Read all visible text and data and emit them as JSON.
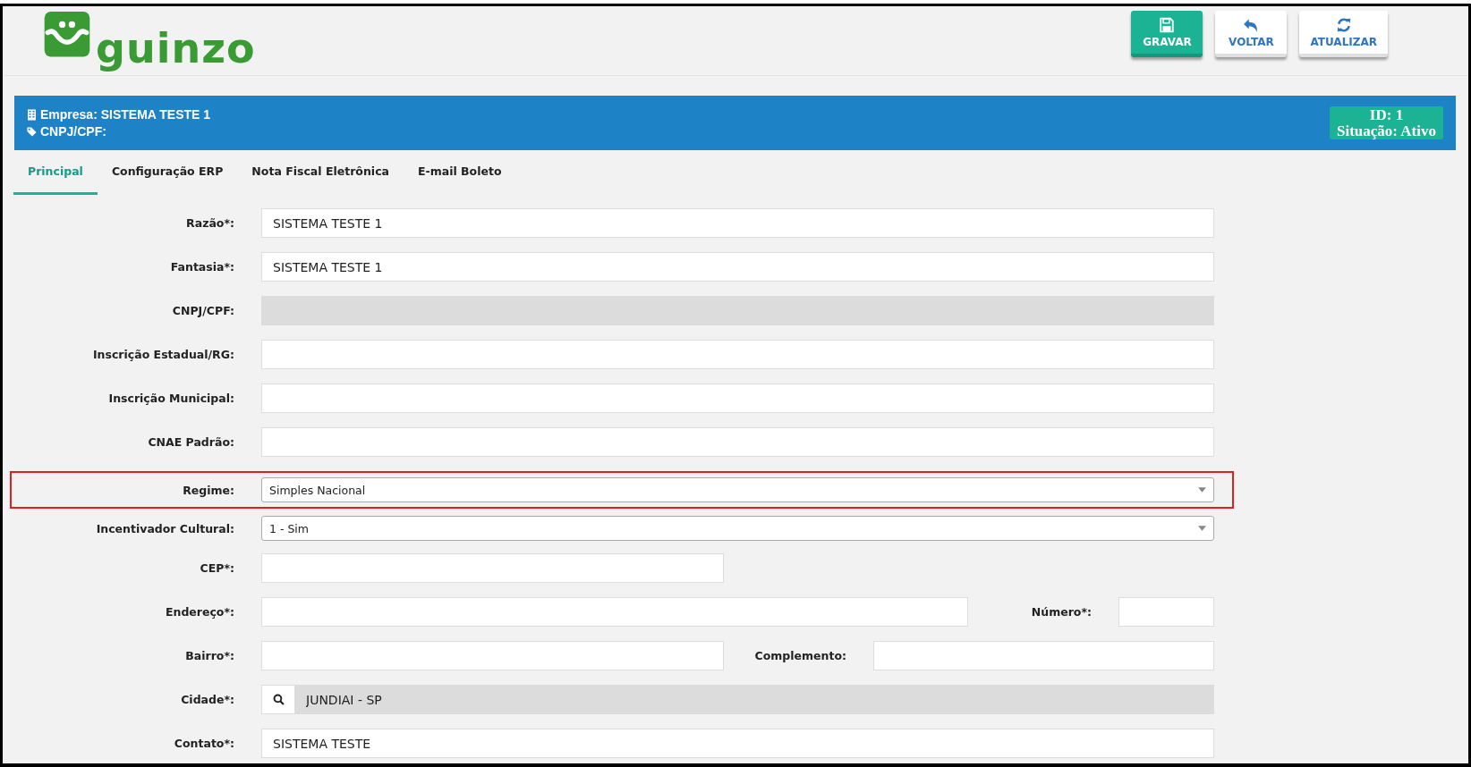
{
  "logo": {
    "text": "guinzo"
  },
  "toolbar": [
    {
      "label": "GRAVAR",
      "kind": "primary"
    },
    {
      "label": "VOLTAR",
      "kind": "back"
    },
    {
      "label": "ATUALIZAR",
      "kind": "refresh"
    }
  ],
  "company_bar": {
    "empresa": "Empresa: SISTEMA TESTE 1",
    "cnpj": "CNPJ/CPF:",
    "id": "ID: 1",
    "situacao": "Situação: Ativo"
  },
  "tabs": [
    {
      "label": "Principal",
      "selected": true
    },
    {
      "label": "Configuração ERP",
      "selected": false
    },
    {
      "label": "Nota Fiscal Eletrônica",
      "selected": false
    },
    {
      "label": "E-mail Boleto",
      "selected": false
    }
  ],
  "rows": [
    {
      "highlighted": false,
      "fields": [
        {
          "label": "Razão*:",
          "kind": "text",
          "value": "SISTEMA TESTE 1"
        }
      ]
    },
    {
      "highlighted": false,
      "fields": [
        {
          "label": "Fantasia*:",
          "kind": "text",
          "value": "SISTEMA TESTE 1"
        }
      ]
    },
    {
      "highlighted": false,
      "fields": [
        {
          "label": "CNPJ/CPF:",
          "kind": "text",
          "disabled": true
        }
      ]
    },
    {
      "highlighted": false,
      "fields": [
        {
          "label": "Inscrição Estadual/RG:",
          "kind": "text"
        }
      ]
    },
    {
      "highlighted": false,
      "fields": [
        {
          "label": "Inscrição Municipal:",
          "kind": "text"
        }
      ]
    },
    {
      "highlighted": false,
      "fields": [
        {
          "label": "CNAE Padrão:",
          "kind": "text"
        }
      ]
    },
    {
      "highlighted": true,
      "fields": [
        {
          "label": "Regime:",
          "kind": "select",
          "value": "Simples Nacional"
        }
      ]
    },
    {
      "highlighted": false,
      "fields": [
        {
          "label": "Incentivador Cultural:",
          "kind": "select",
          "value": "1 - Sim"
        }
      ]
    },
    {
      "highlighted": false,
      "fields": [
        {
          "label": "CEP*:",
          "kind": "text"
        }
      ]
    },
    {
      "highlighted": false,
      "fields": [
        {
          "label": "Endereço*:",
          "kind": "text"
        },
        {
          "label": "Número*:",
          "kind": "text"
        }
      ]
    },
    {
      "highlighted": false,
      "fields": [
        {
          "label": "Bairro*:",
          "kind": "text"
        },
        {
          "label": "Complemento:",
          "kind": "text"
        }
      ]
    },
    {
      "highlighted": false,
      "fields": [
        {
          "label": "Cidade*:",
          "kind": "search",
          "value": "JUNDIAI - SP",
          "disabled": true
        }
      ]
    },
    {
      "highlighted": false,
      "fields": [
        {
          "label": "Contato*:",
          "kind": "text",
          "value": "SISTEMA TESTE"
        }
      ]
    }
  ]
}
